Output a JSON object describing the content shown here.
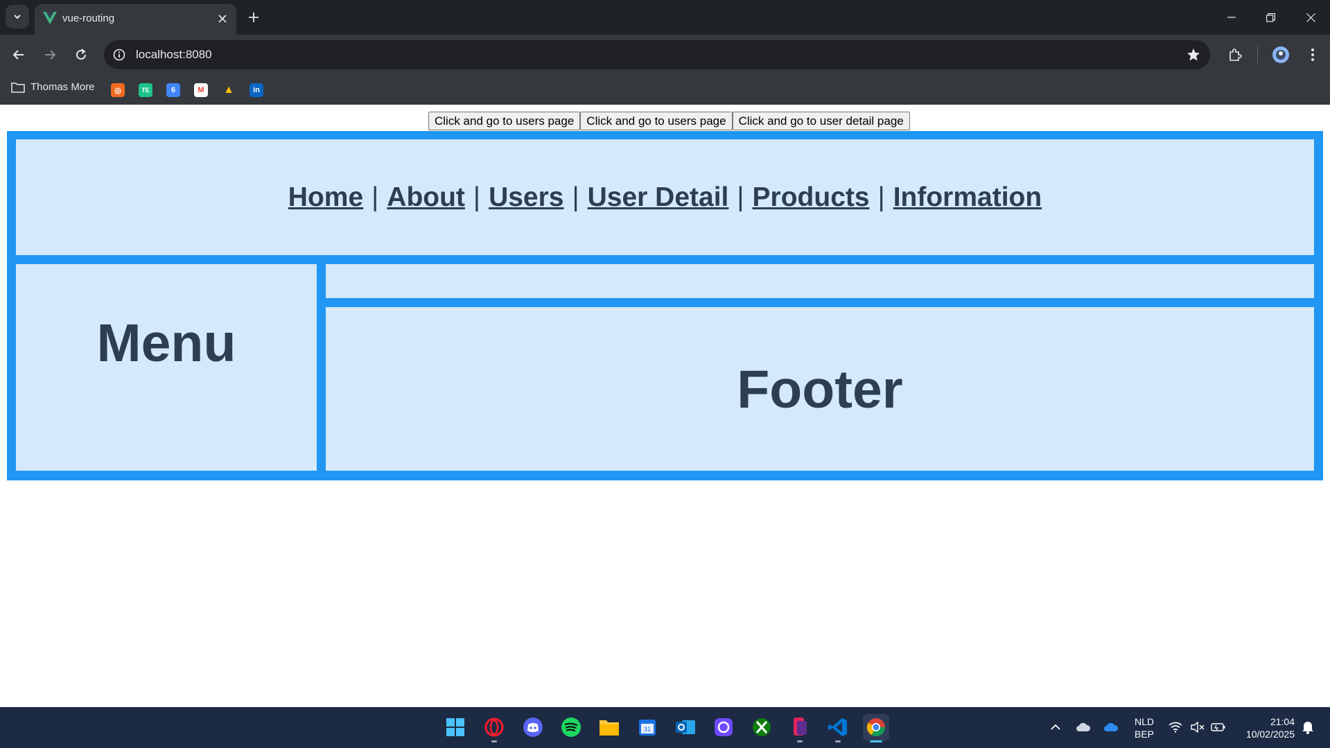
{
  "browser": {
    "tab": {
      "title": "vue-routing"
    },
    "address_bar": {
      "url": "localhost:8080"
    },
    "bookmarks": {
      "folder_label": "Thomas More",
      "items": [
        {
          "icon": "hubspot-icon",
          "glyph": "◎"
        },
        {
          "icon": "te-icon",
          "glyph": "TE"
        },
        {
          "icon": "google-calendar-icon",
          "glyph": "6"
        },
        {
          "icon": "gmail-icon",
          "glyph": "M"
        },
        {
          "icon": "google-drive-icon",
          "glyph": "▲"
        },
        {
          "icon": "linkedin-icon",
          "glyph": "in"
        }
      ]
    }
  },
  "page": {
    "buttons": [
      "Click and go to users page",
      "Click and go to users page",
      "Click and go to user detail page"
    ],
    "nav": {
      "links": [
        "Home",
        "About",
        "Users",
        "User Detail",
        "Products",
        "Information"
      ],
      "separator": "|"
    },
    "menu_title": "Menu",
    "footer_title": "Footer"
  },
  "taskbar": {
    "language": "NLD",
    "keyboard": "BEP",
    "time": "21:04",
    "date": "10/02/2025",
    "apps": [
      "windows-start-icon",
      "opera-icon",
      "discord-icon",
      "spotify-icon",
      "file-explorer-icon",
      "calendar-icon",
      "outlook-icon",
      "proton-icon",
      "xbox-icon",
      "phone-link-icon",
      "vscode-icon",
      "chrome-icon"
    ]
  },
  "colors": {
    "app_border": "#2196f3",
    "panel_bg": "#d4e9fb",
    "text": "#2c3e50"
  }
}
